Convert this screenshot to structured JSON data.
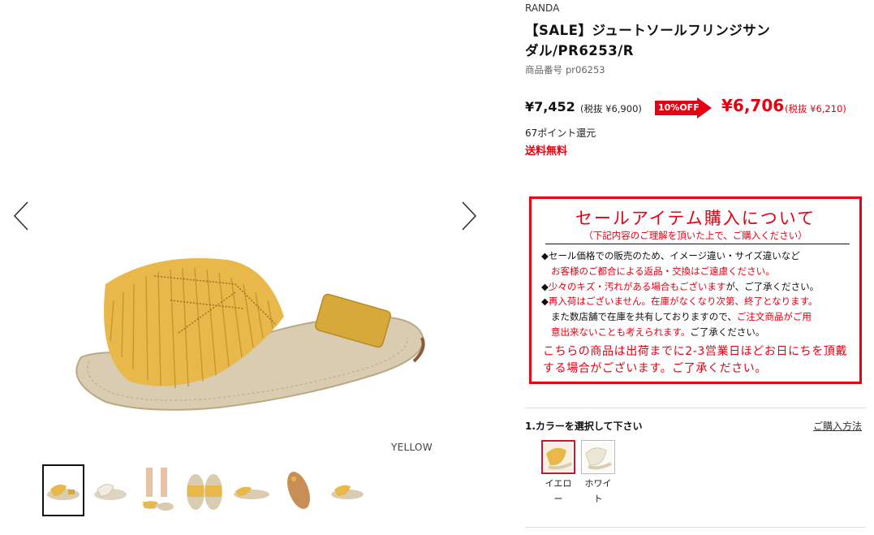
{
  "product": {
    "brand": "RANDA",
    "title": "【SALE】ジュートソールフリンジサンダル/PR6253/R",
    "code_label": "商品番号",
    "code": "pr06253",
    "original_price": "¥7,452",
    "original_tax": "(税抜 ¥6,900)",
    "discount_badge": "10%OFF",
    "sale_price": "¥6,706",
    "sale_tax": "(税抜 ¥6,210)",
    "points": "67ポイント還元",
    "shipping": "送料無料"
  },
  "gallery": {
    "color_caption": "YELLOW",
    "prev_icon": "chevron-left-icon",
    "next_icon": "chevron-right-icon",
    "thumbnail_count": 7,
    "active_thumbnail": 1
  },
  "notice": {
    "title": "セールアイテム購入について",
    "subtitle": "（下記内容のご理解を頂いた上で、ご購入ください）",
    "lines": [
      {
        "prefix": "◆",
        "black": "セール価格での販売のため、イメージ違い・サイズ違いなど",
        "red": ""
      },
      {
        "prefix": "",
        "black": "",
        "red": "お客様のご都合による返品・交換はご遠慮ください。"
      },
      {
        "prefix": "◆",
        "black": "",
        "red": "少々のキズ・汚れがある場合もございます",
        "tail": "が、ご了承ください。"
      },
      {
        "prefix": "◆",
        "black": "",
        "red": "再入荷はございません。在庫がなくなり次第、終了となります。"
      },
      {
        "prefix": "",
        "black": "また数店舗で在庫を共有しておりますので、",
        "red": "ご注文商品がご用"
      },
      {
        "prefix": "",
        "black": "",
        "red": "意出来ないことも考えられます。",
        "tail": "ご了承ください。"
      }
    ],
    "footer": "こちらの商品は出荷までに2-3営業日ほどお日にちを頂戴する場合がございます。ご了承ください。"
  },
  "color_select": {
    "step_label": "1.カラーを選択して下さい",
    "howto_link": "ご購入方法",
    "options": [
      {
        "label": "イエロー",
        "selected": true
      },
      {
        "label": "ホワイト",
        "selected": false
      }
    ]
  },
  "colors": {
    "accent_red": "#e60012",
    "sandal_yellow": "#e8b84a",
    "jute": "#d9ccb0"
  }
}
